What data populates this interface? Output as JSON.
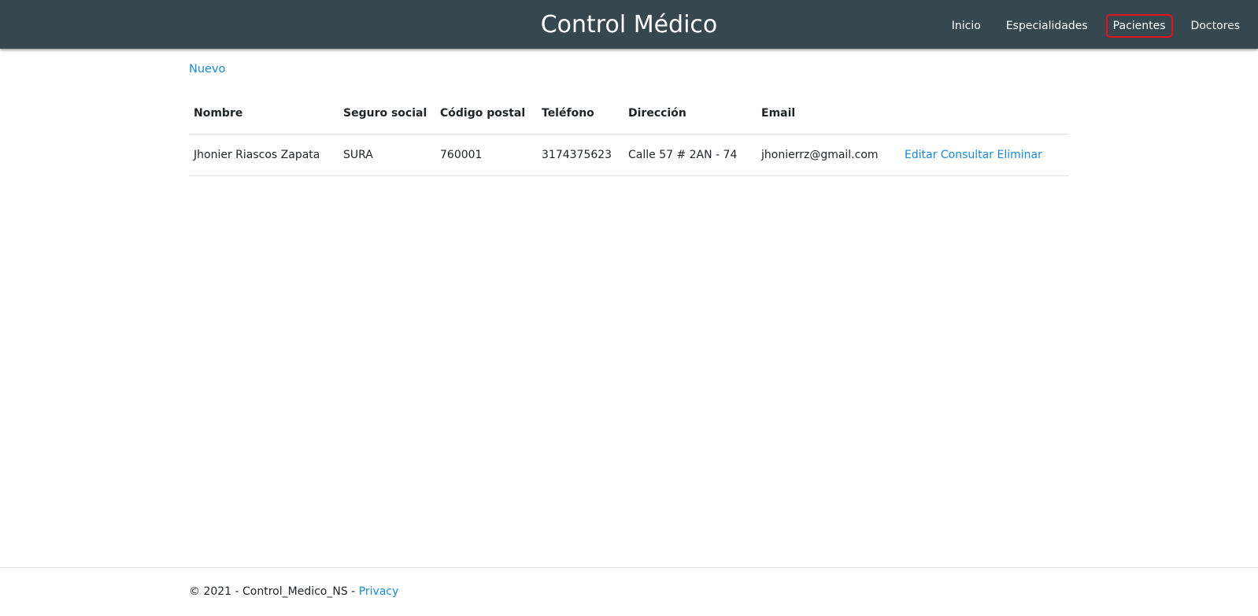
{
  "header": {
    "brand": "Control Médico",
    "nav": [
      {
        "label": "Inicio"
      },
      {
        "label": "Especialidades"
      },
      {
        "label": "Pacientes"
      },
      {
        "label": "Doctores"
      }
    ],
    "active_nav": "Pacientes"
  },
  "main": {
    "new_link": "Nuevo",
    "table": {
      "columns": [
        "Nombre",
        "Seguro social",
        "Código postal",
        "Teléfono",
        "Dirección",
        "Email",
        ""
      ],
      "rows": [
        {
          "nombre": "Jhonier Riascos Zapata",
          "seguro": "SURA",
          "postal": "760001",
          "telefono": "3174375623",
          "direccion": "Calle 57 # 2AN - 74",
          "email": "jhonierrz@gmail.com",
          "actions": {
            "edit": "Editar",
            "view": "Consultar",
            "delete": "Eliminar"
          }
        }
      ]
    }
  },
  "footer": {
    "copyright": "© 2021 - Control_Medico_NS - ",
    "privacy": "Privacy"
  },
  "colors": {
    "navbar": "#37474f",
    "link": "#1b8ad6",
    "active_outline": "#e0141a"
  }
}
